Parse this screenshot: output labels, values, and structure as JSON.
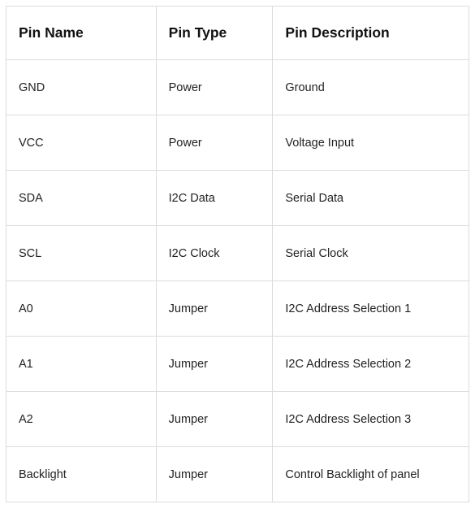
{
  "table": {
    "headers": [
      "Pin Name",
      "Pin Type",
      "Pin Description"
    ],
    "rows": [
      [
        "GND",
        "Power",
        "Ground"
      ],
      [
        "VCC",
        "Power",
        "Voltage Input"
      ],
      [
        "SDA",
        "I2C Data",
        "Serial Data"
      ],
      [
        "SCL",
        "I2C Clock",
        "Serial Clock"
      ],
      [
        "A0",
        "Jumper",
        "I2C Address Selection 1"
      ],
      [
        "A1",
        "Jumper",
        "I2C Address Selection 2"
      ],
      [
        "A2",
        "Jumper",
        "I2C Address Selection 3"
      ],
      [
        "Backlight",
        "Jumper",
        "Control Backlight of panel"
      ]
    ]
  }
}
